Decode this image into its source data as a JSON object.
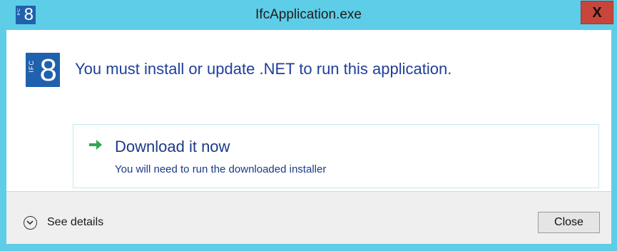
{
  "window": {
    "title": "IfcApplication.exe",
    "close_glyph": "X",
    "app_icon": {
      "name": "ifc-8-logo-icon",
      "small_text": "IFC",
      "big_text": "8"
    }
  },
  "content": {
    "logo": {
      "name": "ifc-8-logo",
      "small_text": "IFC",
      "big_text": "8"
    },
    "main_instruction": "You must install or update .NET to run this application.",
    "command_link": {
      "icon": "green-arrow-right-icon",
      "title": "Download it now",
      "subtitle": "You will need to run the downloaded installer"
    }
  },
  "footer": {
    "details_label": "See details",
    "details_icon": "chevron-down-circle-icon",
    "close_label": "Close"
  },
  "colors": {
    "title_bar": "#5ecde8",
    "close_x_bg": "#c7453b",
    "logo_blue": "#1f61ac",
    "instruction_text": "#1f3f9a",
    "arrow_green": "#2fa84f"
  }
}
